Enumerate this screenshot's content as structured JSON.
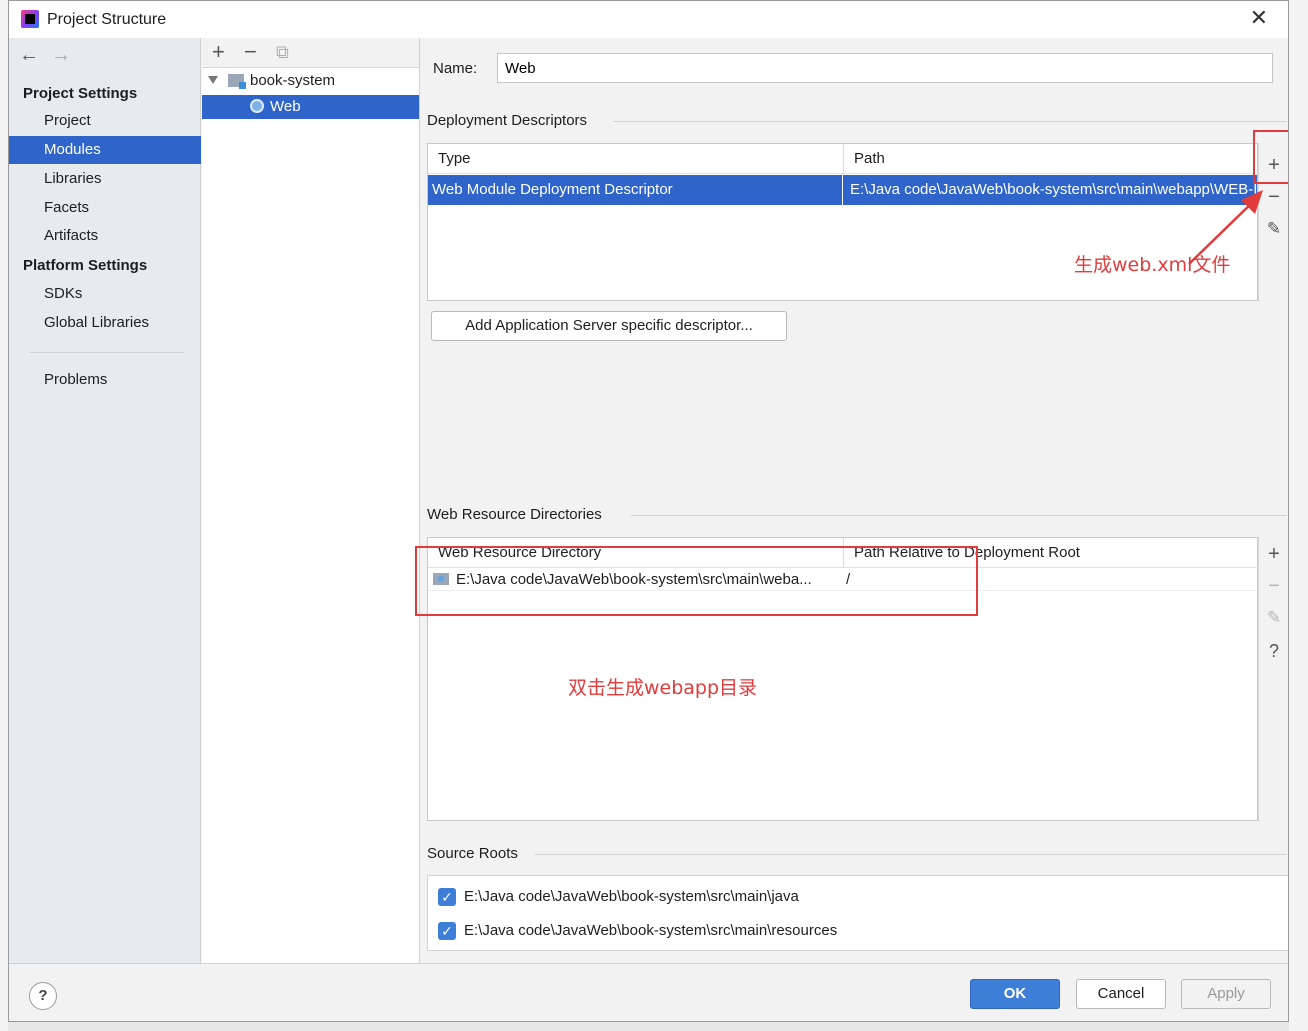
{
  "window": {
    "title": "Project Structure",
    "close_glyph": "✕"
  },
  "sidebar": {
    "back_glyph": "←",
    "forward_glyph": "→",
    "project_settings_heading": "Project Settings",
    "project_settings_items": [
      "Project",
      "Modules",
      "Libraries",
      "Facets",
      "Artifacts"
    ],
    "platform_settings_heading": "Platform Settings",
    "platform_settings_items": [
      "SDKs",
      "Global Libraries"
    ],
    "problems_label": "Problems",
    "selected_item": "Modules"
  },
  "tree": {
    "toolbar": {
      "add": "+",
      "remove": "−",
      "copy": "⧉"
    },
    "root_label": "book-system",
    "child_label": "Web",
    "selected_item": "Web"
  },
  "content": {
    "name_label": "Name:",
    "name_value": "Web",
    "deployment": {
      "title": "Deployment Descriptors",
      "columns": [
        "Type",
        "Path"
      ],
      "row": {
        "type": "Web Module Deployment Descriptor",
        "path": "E:\\Java code\\JavaWeb\\book-system\\src\\main\\webapp\\WEB-INF\\web.xml"
      },
      "tools": {
        "add": "+",
        "remove": "−",
        "edit": "✎"
      },
      "add_server_button": "Add Application Server specific descriptor..."
    },
    "web_resource": {
      "title": "Web Resource Directories",
      "columns": [
        "Web Resource Directory",
        "Path Relative to Deployment Root"
      ],
      "row": {
        "directory": "E:\\Java code\\JavaWeb\\book-system\\src\\main\\weba...",
        "relative": "/"
      },
      "tools": {
        "add": "+",
        "remove": "−",
        "edit": "✎",
        "help": "?"
      }
    },
    "source_roots": {
      "title": "Source Roots",
      "items": [
        "E:\\Java code\\JavaWeb\\book-system\\src\\main\\java",
        "E:\\Java code\\JavaWeb\\book-system\\src\\main\\resources"
      ],
      "check_glyph": "✓"
    }
  },
  "annotations": {
    "generate_web_xml": "生成web.xml文件",
    "double_click_webapp": "双击生成webapp目录"
  },
  "footer": {
    "help": "?",
    "ok": "OK",
    "cancel": "Cancel",
    "apply": "Apply"
  },
  "colors": {
    "selection": "#2f65ca",
    "annotation": "#e23b3b",
    "primary_button": "#3d7ed6"
  }
}
